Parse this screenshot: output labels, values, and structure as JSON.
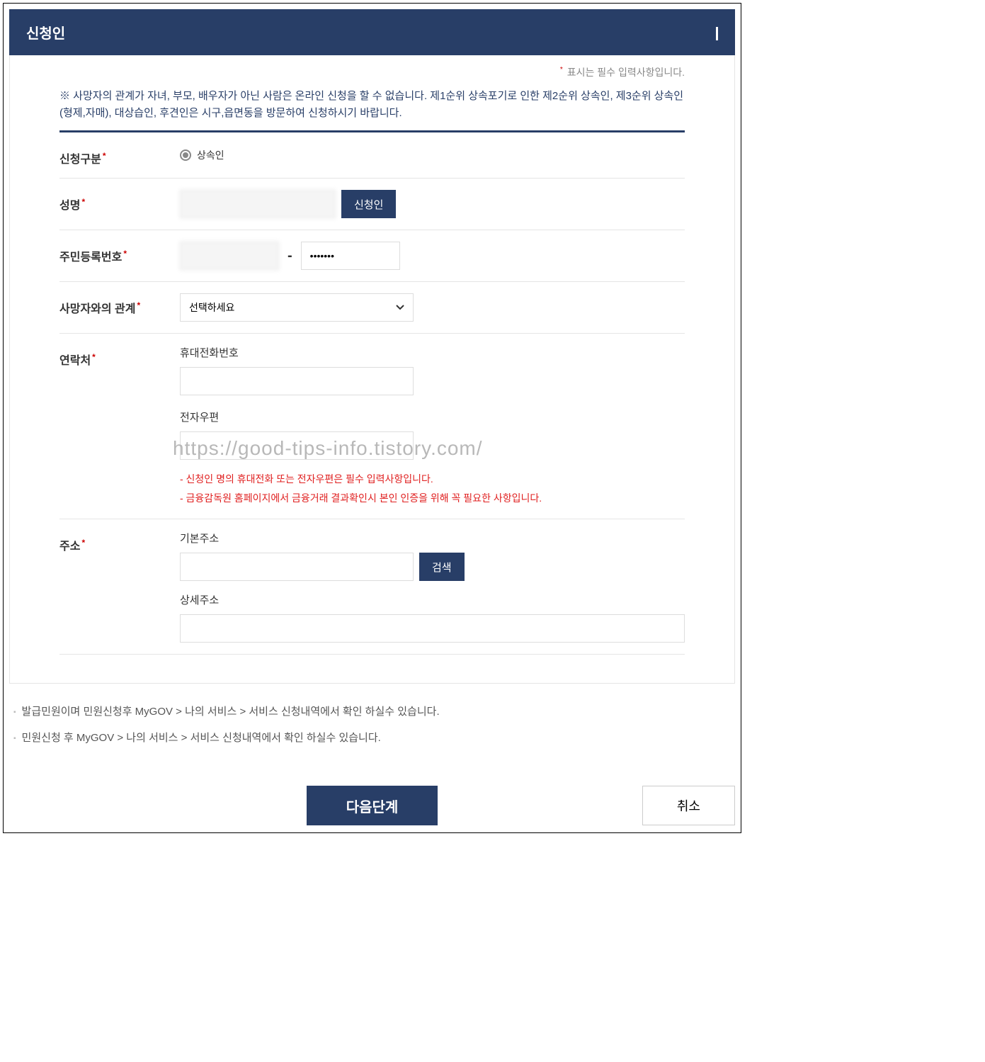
{
  "panel_title": "신청인",
  "required_note": "표시는 필수 입력사항입니다.",
  "required_star": "*",
  "notice_text": "※ 사망자의 관계가 자녀, 부모, 배우자가 아닌 사람은 온라인 신청을 할 수 없습니다. 제1순위 상속포기로 인한 제2순위 상속인, 제3순위 상속인(형제,자매), 대상습인, 후견인은 시구,읍면동을 방문하여 신청하시기 바랍니다.",
  "labels": {
    "type": "신청구분",
    "name": "성명",
    "rrn": "주민등록번호",
    "relation": "사망자와의 관계",
    "contact": "연락처",
    "address": "주소"
  },
  "radio_label": "상속인",
  "name_value": "",
  "name_button": "신청인",
  "rrn_first": "",
  "rrn_second": "•••••••",
  "rrn_dash": "-",
  "relation_placeholder": "선택하세요",
  "contact": {
    "phone_label": "휴대전화번호",
    "email_label": "전자우편"
  },
  "red_notes": [
    "- 신청인 명의 휴대전화 또는 전자우편은 필수 입력사항입니다.",
    "- 금융감독원 홈페이지에서 금융거래 결과확인시 본인 인증을 위해 꼭 필요한 사항입니다."
  ],
  "address": {
    "base_label": "기본주소",
    "search_button": "검색",
    "detail_label": "상세주소"
  },
  "footer_notes": [
    "발급민원이며 민원신청후 MyGOV > 나의 서비스 > 서비스 신청내역에서 확인 하실수 있습니다.",
    "민원신청 후 MyGOV > 나의 서비스 > 서비스 신청내역에서 확인 하실수 있습니다."
  ],
  "actions": {
    "next": "다음단계",
    "cancel": "취소"
  },
  "watermark": "https://good-tips-info.tistory.com/"
}
